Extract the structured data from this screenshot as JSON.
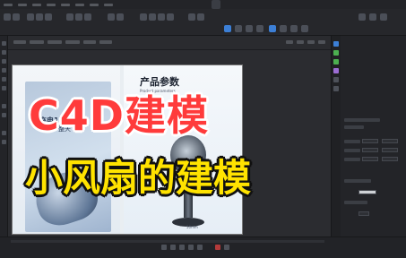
{
  "app": {
    "window_title": "",
    "layout_label": ""
  },
  "overlay": {
    "title": "C4D建模",
    "subtitle": "小风扇的建模",
    "title_color": "#ff3b3b",
    "subtitle_color": "#ffe300"
  },
  "reference_image": {
    "left_heading": "充电1次",
    "left_subheading": "清凉一整天",
    "right_heading": "产品参数",
    "right_subheading": "Product parameters",
    "dimension_label": "50mm"
  },
  "colors": {
    "background": "#1e1f22",
    "panel": "#232428",
    "accent": "#3c7fd6"
  }
}
